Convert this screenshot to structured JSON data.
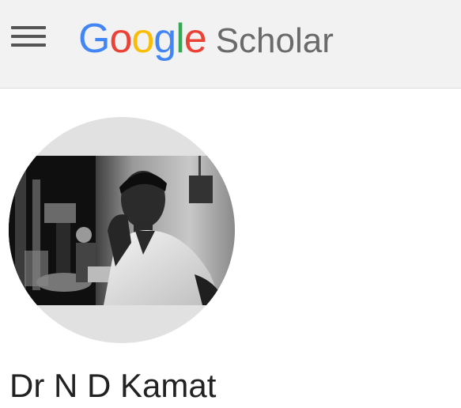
{
  "header": {
    "menu_icon": "hamburger-menu-icon",
    "logo": {
      "google_letters": [
        {
          "char": "G",
          "color": "#4285F4"
        },
        {
          "char": "o",
          "color": "#EA4335"
        },
        {
          "char": "o",
          "color": "#FBBC05"
        },
        {
          "char": "g",
          "color": "#4285F4"
        },
        {
          "char": "l",
          "color": "#34A853"
        },
        {
          "char": "e",
          "color": "#EA4335"
        }
      ],
      "product": "Scholar"
    }
  },
  "profile": {
    "name": "Dr N D Kamat",
    "avatar": "profile-photo"
  }
}
